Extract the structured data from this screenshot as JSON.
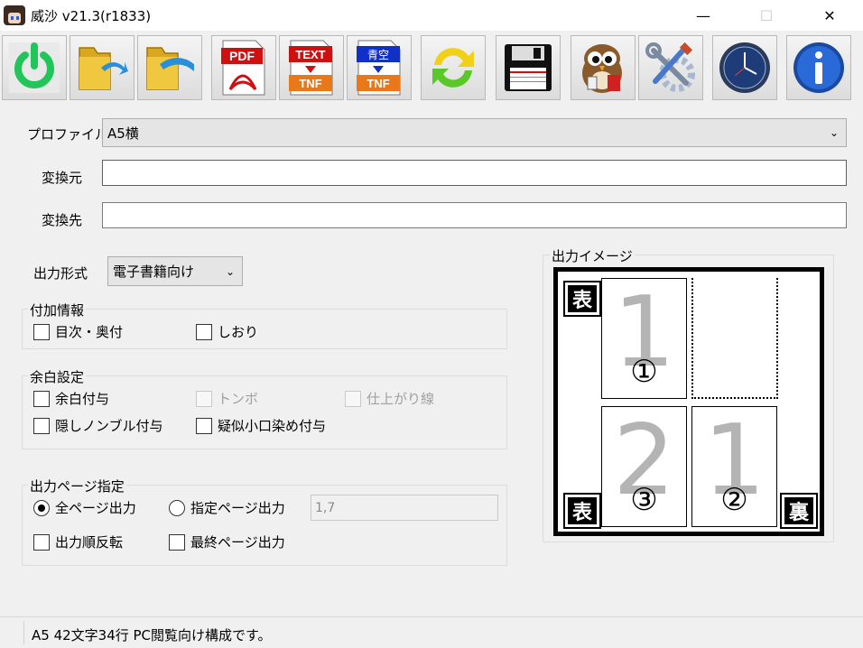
{
  "window": {
    "title": "威沙 v21.3(r1833)",
    "minimize": "—",
    "maximize": "☐",
    "close": "✕"
  },
  "toolbar": {
    "buttons": [
      {
        "icon": "power-icon"
      },
      {
        "icon": "open-folder-icon"
      },
      {
        "icon": "open-folder-back-icon"
      },
      {
        "icon": "pdf-icon",
        "text": "PDF"
      },
      {
        "icon": "text-tnf-icon",
        "text": "TEXT",
        "sub": "TNF"
      },
      {
        "icon": "aozora-tnf-icon",
        "text": "青空",
        "sub": "TNF"
      },
      {
        "icon": "refresh-icon"
      },
      {
        "icon": "floppy-save-icon"
      },
      {
        "icon": "owl-icon"
      },
      {
        "icon": "tools-icon"
      },
      {
        "icon": "clock-icon"
      },
      {
        "icon": "info-icon",
        "text": "i"
      }
    ]
  },
  "form": {
    "profile_label": "プロファイル",
    "profile_value": "A5横",
    "source_label": "変換元",
    "source_value": "",
    "dest_label": "変換先",
    "dest_value": "",
    "output_format_label": "出力形式",
    "output_format_value": "電子書籍向け"
  },
  "additional_info": {
    "title": "付加情報",
    "toc": "目次・奥付",
    "bookmark": "しおり"
  },
  "margin": {
    "title": "余白設定",
    "add_margin": "余白付与",
    "tombo": "トンボ",
    "finish_line": "仕上がり線",
    "hidden_nombre": "隠しノンブル付与",
    "pseudo_edge": "疑似小口染め付与"
  },
  "output_pages": {
    "title": "出力ページ指定",
    "all_pages": "全ページ出力",
    "specified_pages": "指定ページ出力",
    "pages_value": "1,7",
    "reverse_order": "出力順反転",
    "last_page": "最終ページ出力"
  },
  "preview": {
    "title": "出力イメージ",
    "front": "表",
    "back": "裏",
    "page1": "1",
    "page2": "2",
    "page1_circ": "①",
    "page2_circ": "③",
    "page3_circ": "②"
  },
  "status": {
    "text": "A5 42文字34行 PC閲覧向け構成です。"
  }
}
